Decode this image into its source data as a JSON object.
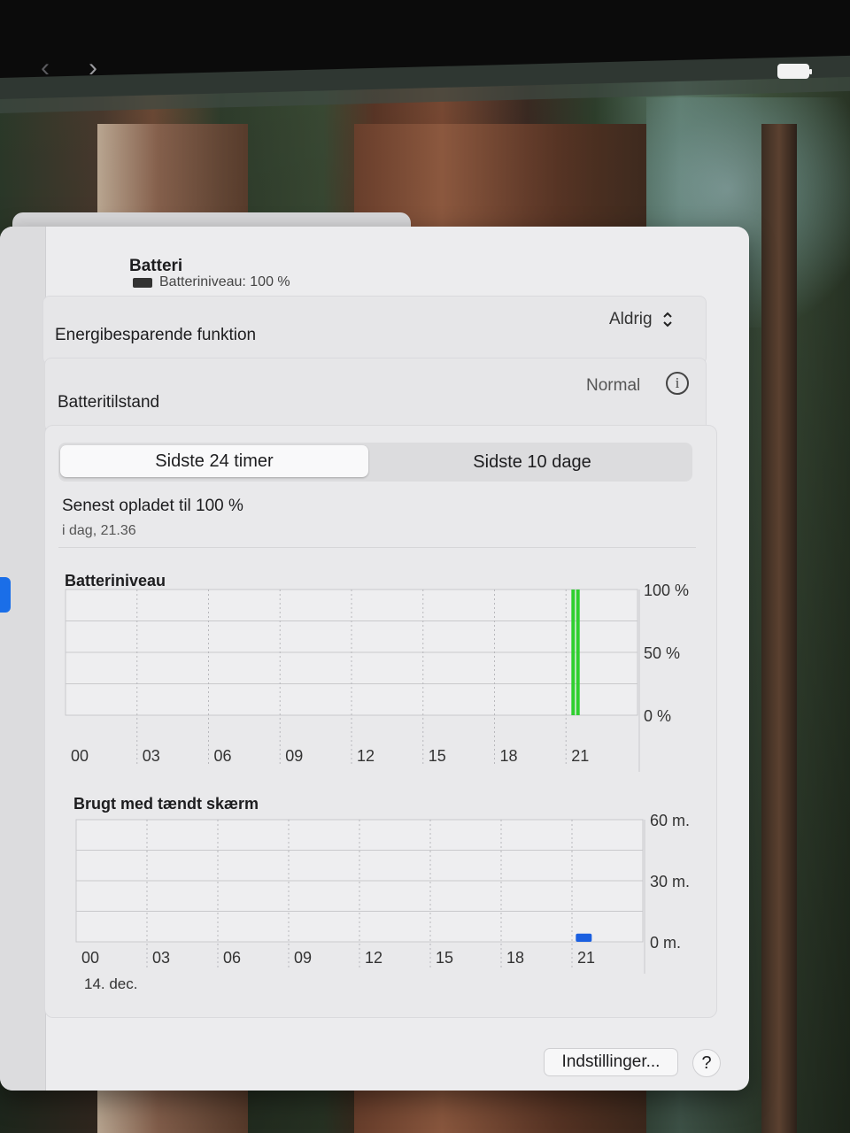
{
  "window": {
    "title": "Batteri",
    "subtitle": "Batteriniveau: 100 %"
  },
  "rows": {
    "energy_label": "Energibesparende funktion",
    "energy_value": "Aldrig",
    "energy_chevron": "⌃⌄",
    "health_label": "Batteritilstand",
    "health_value": "Normal",
    "info_glyph": "i"
  },
  "tabs": [
    {
      "label": "Sidste 24 timer",
      "selected": true
    },
    {
      "label": "Sidste 10 dage",
      "selected": false
    }
  ],
  "last_charged": {
    "text": "Senest opladet til 100 %",
    "time": "i dag, 21.36"
  },
  "charts_text": {
    "level_title": "Batteriniveau",
    "screen_title": "Brugt med tændt skærm",
    "date_label": "14. dec."
  },
  "chart_data": [
    {
      "type": "bar",
      "title": "Batteriniveau",
      "categories": [
        "00",
        "03",
        "06",
        "09",
        "12",
        "15",
        "18",
        "21"
      ],
      "y_tick_labels": [
        "100 %",
        "50 %",
        "0 %"
      ],
      "ylim": [
        0,
        100
      ],
      "unit": "%",
      "bars": [
        {
          "hour": 21.3,
          "value": 100,
          "color": "#2fcf2f"
        },
        {
          "hour": 21.5,
          "value": 100,
          "color": "#2fcf2f"
        }
      ],
      "grid": true
    },
    {
      "type": "bar",
      "title": "Brugt med tændt skærm",
      "categories": [
        "00",
        "03",
        "06",
        "09",
        "12",
        "15",
        "18",
        "21"
      ],
      "y_tick_labels": [
        "60 m.",
        "30 m.",
        "0 m."
      ],
      "ylim": [
        0,
        60
      ],
      "unit": "min",
      "bars": [
        {
          "hour": 21.5,
          "value": 4,
          "color": "#1a5fe0"
        }
      ],
      "grid": true
    }
  ],
  "buttons": {
    "settings": "Indstillinger...",
    "help": "?"
  }
}
